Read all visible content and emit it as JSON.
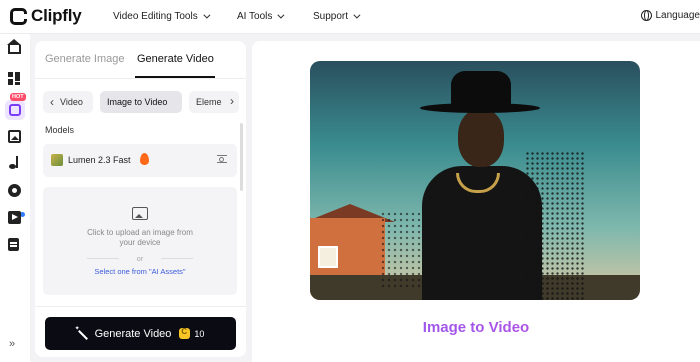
{
  "brand": {
    "name": "Clipfly"
  },
  "topnav": {
    "items": [
      "Video Editing Tools",
      "AI Tools",
      "Support"
    ],
    "language_label": "Language"
  },
  "rail": {
    "hot_badge": "HOT",
    "expand_glyph": "»"
  },
  "panel": {
    "tabs": [
      "Generate Image",
      "Generate Video"
    ],
    "active_tab": "Generate Video",
    "chips": [
      "Video",
      "Image to Video",
      "Eleme"
    ],
    "active_chip": "Image to Video",
    "models_label": "Models",
    "model": {
      "name": "Lumen 2.3 Fast"
    },
    "upload": {
      "text": "Click to upload an image from your device",
      "or": "or",
      "select_link": "Select one from \"AI Assets\""
    },
    "generate": {
      "label": "Generate Video",
      "credits": "10"
    }
  },
  "preview": {
    "caption": "Image to Video"
  },
  "colors": {
    "accent": "#7b3cf5",
    "button_bg": "#0b0b14",
    "hot_badge": "#ff4d6a",
    "link": "#3b5bdb"
  }
}
